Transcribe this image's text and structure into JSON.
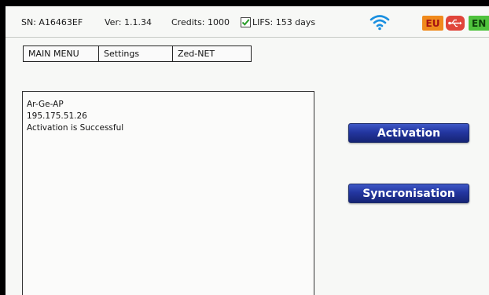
{
  "status_bar": {
    "serial": "SN: A16463EF",
    "version": "Ver: 1.1.34",
    "credits": "Credits: 1000",
    "lifs": "LIFS: 153 days",
    "lifs_checked": true,
    "wifi_icon": "wifi-icon",
    "region_badge": "EU",
    "usb_icon": "usb-icon",
    "language_badge": "EN",
    "colors": {
      "wifi": "#1a8fe0",
      "eu_bg": "#f08a1c",
      "usb_bg": "#e0453a",
      "en_bg": "#4fc23d"
    }
  },
  "tabs": [
    {
      "label": "MAIN MENU"
    },
    {
      "label": "Settings"
    },
    {
      "label": "Zed-NET"
    }
  ],
  "output_panel": {
    "lines": [
      "Ar-Ge-AP",
      "195.175.51.26",
      "Activation is Successful"
    ]
  },
  "buttons": {
    "activation": "Activation",
    "sync": "Syncronisation",
    "color": "#2336a0"
  }
}
